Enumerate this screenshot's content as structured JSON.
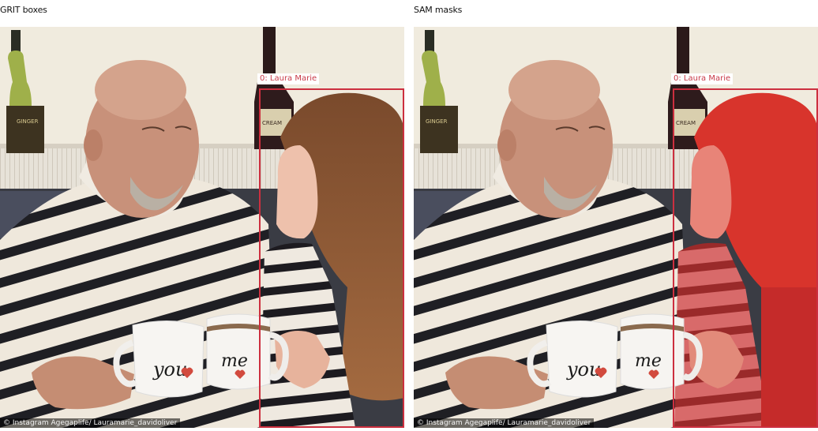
{
  "panels": {
    "left": {
      "title": "GRIT boxes",
      "credit": "© Instagram Agegaplife/ Lauramarie_davidoliver"
    },
    "right": {
      "title": "SAM masks",
      "credit": "© Instagram Agegaplife/ Lauramarie_davidoliver"
    }
  },
  "detection": {
    "label": "0: Laura Marie",
    "box_color": "#cc2f3f",
    "mask_color": "#d8342c"
  },
  "photo": {
    "bottle_label_left": "GINGER",
    "bottle_label_right": "CREAM",
    "mug_left_text": "you",
    "mug_right_text": "me",
    "heart_color": "#d24a3e"
  }
}
